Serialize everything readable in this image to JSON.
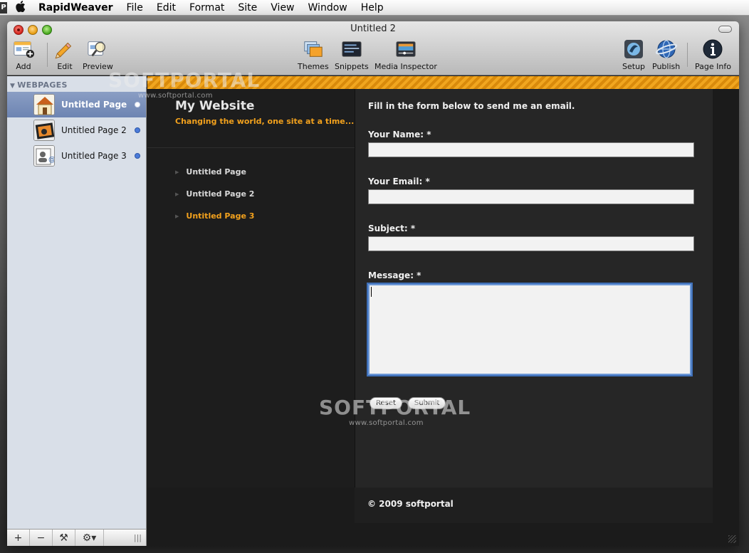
{
  "menubar": {
    "app_badge": "P",
    "apple": "",
    "app_name": "RapidWeaver",
    "menus": [
      "File",
      "Edit",
      "Format",
      "Site",
      "View",
      "Window",
      "Help"
    ]
  },
  "window": {
    "title": "Untitled 2"
  },
  "toolbar": {
    "add": "Add",
    "edit": "Edit",
    "preview": "Preview",
    "themes": "Themes",
    "snippets": "Snippets",
    "media_inspector": "Media Inspector",
    "setup": "Setup",
    "publish": "Publish",
    "page_info": "Page Info"
  },
  "sidebar": {
    "header": "WEBPAGES",
    "items": [
      {
        "label": "Untitled Page",
        "selected": true,
        "icon": "home-page-icon"
      },
      {
        "label": "Untitled Page 2",
        "selected": false,
        "icon": "photo-album-page-icon"
      },
      {
        "label": "Untitled Page 3",
        "selected": false,
        "icon": "contact-form-page-icon"
      }
    ],
    "bottom_buttons": {
      "add": "+",
      "remove": "−",
      "tools": "⚒",
      "gear": "⚙▾",
      "grip": "|||"
    }
  },
  "site": {
    "title": "My Website",
    "slogan": "Changing the world, one site at a time...",
    "nav": [
      "Untitled Page",
      "Untitled Page 2",
      "Untitled Page 3"
    ],
    "nav_current_index": 2,
    "form": {
      "intro": "Fill in the form below to send me an email.",
      "name_label": "Your Name: *",
      "email_label": "Your Email: *",
      "subject_label": "Subject: *",
      "message_label": "Message: *",
      "name_value": "",
      "email_value": "",
      "subject_value": "",
      "message_value": "",
      "reset": "Reset",
      "submit": "Submit"
    },
    "footer": "© 2009 softportal"
  },
  "watermark": {
    "brand": "SOFTPORTAL",
    "url": "www.softportal.com"
  },
  "colors": {
    "accent_orange": "#f2a11d",
    "selection_blue": "#7b90bb",
    "focus_ring": "#3e6fb8"
  }
}
